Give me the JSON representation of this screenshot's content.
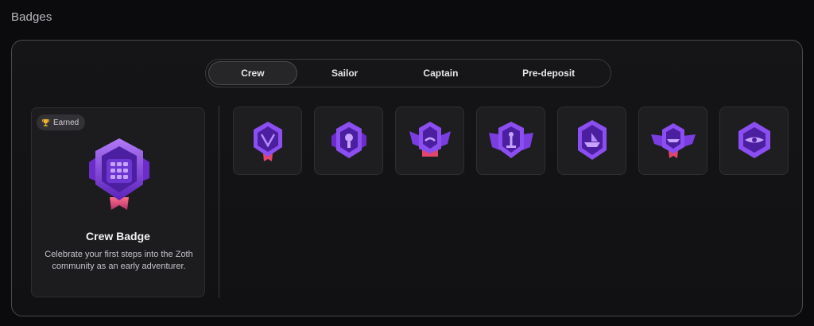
{
  "page": {
    "title": "Badges"
  },
  "tabs": [
    {
      "label": "Crew",
      "active": true
    },
    {
      "label": "Sailor",
      "active": false
    },
    {
      "label": "Captain",
      "active": false
    },
    {
      "label": "Pre-deposit",
      "active": false
    }
  ],
  "detail": {
    "status": "Earned",
    "status_icon": "trophy-icon",
    "title": "Crew Badge",
    "description": "Celebrate your first steps into the Zoth community as an early adventurer."
  },
  "badges": [
    {
      "icon": "shield-badge-icon"
    },
    {
      "icon": "lamp-badge-icon"
    },
    {
      "icon": "winged-badge-icon"
    },
    {
      "icon": "anchor-badge-icon"
    },
    {
      "icon": "ship-badge-icon"
    },
    {
      "icon": "winged-ship-badge-icon"
    },
    {
      "icon": "compass-badge-icon"
    }
  ],
  "colors": {
    "accent": "#7b3fe4",
    "accent_light": "#a56cf2",
    "accent_dark": "#4b1fa0",
    "ribbon": "#e0456a"
  }
}
